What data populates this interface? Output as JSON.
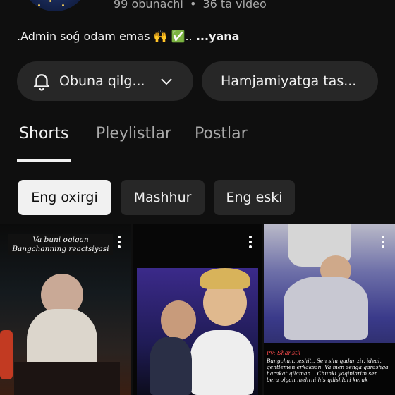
{
  "channel": {
    "subscribers": "99 obunachi",
    "separator": "•",
    "videos": "36 ta video",
    "description": ".Admin soǵ odam emas 🙌 ✅..",
    "more": "...yana"
  },
  "actions": {
    "subscribe_label": "Obuna qilg...",
    "community_label": "Hamjamiyatga tas..."
  },
  "tabs": [
    "Shorts",
    "Pleylistlar",
    "Postlar"
  ],
  "filters": [
    "Eng oxirgi",
    "Mashhur",
    "Eng eski"
  ],
  "shorts": [
    {
      "caption": "Va buni oqigan Bangchanning reactsiyasi"
    },
    {
      "caption": ""
    },
    {
      "tag": "Pv: Shar.stk",
      "caption": "Bangchan...eshit.. Sen shu qadar zir, ideal, gentlemen erkaksan. Va men senga qarashga harakat qilaman... Chunki yaqinlarim sen bera olgan mehrni his qilishlari kerak"
    }
  ],
  "colors": {
    "background": "#0f0f0f",
    "pill": "#272727",
    "active_chip": "#f1f1f1"
  }
}
